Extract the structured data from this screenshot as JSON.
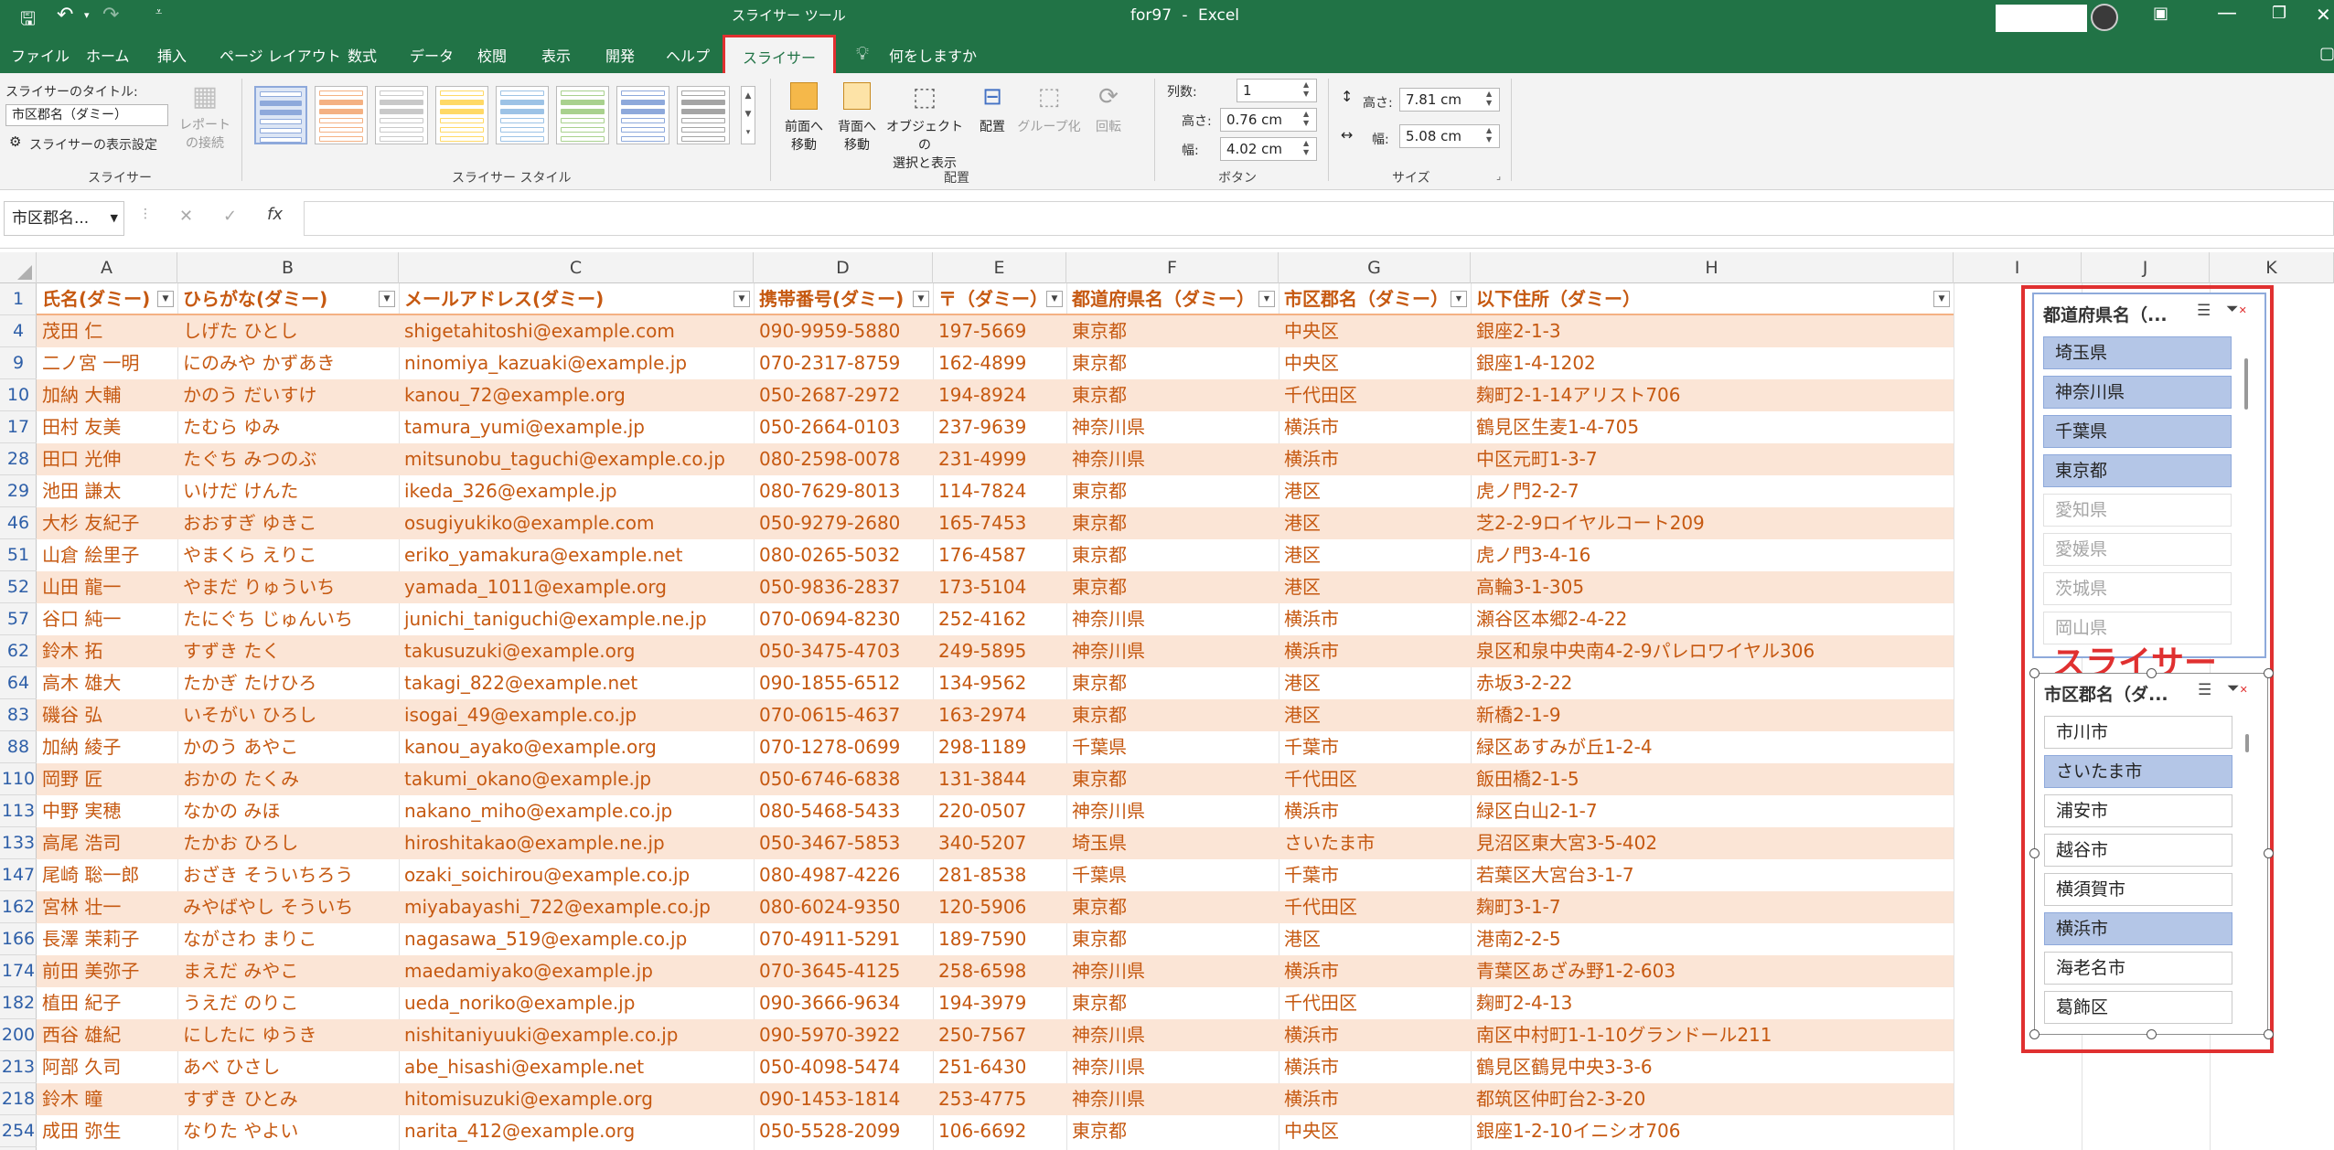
{
  "window": {
    "file_name": "for97",
    "separator": "-",
    "app_name": "Excel",
    "context_tool": "スライサー ツール"
  },
  "tabs": [
    "ファイル",
    "ホーム",
    "挿入",
    "ページ レイアウト",
    "数式",
    "データ",
    "校閲",
    "表示",
    "開発",
    "ヘルプ",
    "スライサー"
  ],
  "active_tab": "スライサー",
  "tell_me": "何をしますか",
  "ribbon": {
    "slicer_caption_label": "スライサーのタイトル:",
    "slicer_caption_value": "市区郡名（ダミー）",
    "slicer_settings": "スライサーの表示設定",
    "report_connections": [
      "レポート",
      "の接続"
    ],
    "group_slicer": "スライサー",
    "group_styles": "スライサー スタイル",
    "bring_forward": [
      "前面へ",
      "移動"
    ],
    "send_backward": [
      "背面へ",
      "移動"
    ],
    "selection_pane": [
      "オブジェクトの",
      "選択と表示"
    ],
    "align": "配置",
    "group": "グループ化",
    "rotate": "回転",
    "group_arrange": "配置",
    "columns_label": "列数:",
    "columns_value": "1",
    "btn_height_label": "高さ:",
    "btn_height_value": "0.76 cm",
    "btn_width_label": "幅:",
    "btn_width_value": "4.02 cm",
    "group_buttons": "ボタン",
    "size_height_label": "高さ:",
    "size_height_value": "7.81 cm",
    "size_width_label": "幅:",
    "size_width_value": "5.08 cm",
    "group_size": "サイズ"
  },
  "style_colors": [
    "#8ea9db",
    "#f4b183",
    "#c9c9c9",
    "#ffd966",
    "#9dc3e6",
    "#a9d18e",
    "#8ea9db",
    "#a5a5a5",
    "#9dc3e6"
  ],
  "formula_bar": {
    "name_box": "市区郡名...",
    "cancel": "✕",
    "enter": "✓",
    "fx": "fx",
    "formula": ""
  },
  "columns": [
    "A",
    "B",
    "C",
    "D",
    "E",
    "F",
    "G",
    "H",
    "I",
    "J",
    "K"
  ],
  "table_headers": [
    "氏名(ダミー)",
    "ひらがな(ダミー)",
    "メールアドレス(ダミー)",
    "携帯番号(ダミー)",
    "〒（ダミー）",
    "都道府県名（ダミー）",
    "市区郡名（ダミー）",
    "以下住所（ダミー）"
  ],
  "header_row_number": "1",
  "rows": [
    {
      "n": "4",
      "c": [
        "茂田 仁",
        "しげた ひとし",
        "shigetahitoshi@example.com",
        "090-9959-5880",
        "197-5669",
        "東京都",
        "中央区",
        "銀座2-1-3"
      ]
    },
    {
      "n": "9",
      "c": [
        "二ノ宮 一明",
        "にのみや かずあき",
        "ninomiya_kazuaki@example.jp",
        "070-2317-8759",
        "162-4899",
        "東京都",
        "中央区",
        "銀座1-4-1202"
      ]
    },
    {
      "n": "10",
      "c": [
        "加納 大輔",
        "かのう だいすけ",
        "kanou_72@example.org",
        "050-2687-2972",
        "194-8924",
        "東京都",
        "千代田区",
        "麹町2-1-14アリスト706"
      ]
    },
    {
      "n": "17",
      "c": [
        "田村 友美",
        "たむら ゆみ",
        "tamura_yumi@example.jp",
        "050-2664-0103",
        "237-9639",
        "神奈川県",
        "横浜市",
        "鶴見区生麦1-4-705"
      ]
    },
    {
      "n": "28",
      "c": [
        "田口 光伸",
        "たぐち みつのぶ",
        "mitsunobu_taguchi@example.co.jp",
        "080-2598-0078",
        "231-4999",
        "神奈川県",
        "横浜市",
        "中区元町1-3-7"
      ]
    },
    {
      "n": "29",
      "c": [
        "池田 謙太",
        "いけだ けんた",
        "ikeda_326@example.jp",
        "080-7629-8013",
        "114-7824",
        "東京都",
        "港区",
        "虎ノ門2-2-7"
      ]
    },
    {
      "n": "46",
      "c": [
        "大杉 友紀子",
        "おおすぎ ゆきこ",
        "osugiyukiko@example.com",
        "050-9279-2680",
        "165-7453",
        "東京都",
        "港区",
        "芝2-2-9ロイヤルコート209"
      ]
    },
    {
      "n": "51",
      "c": [
        "山倉 絵里子",
        "やまくら えりこ",
        "eriko_yamakura@example.net",
        "080-0265-5032",
        "176-4587",
        "東京都",
        "港区",
        "虎ノ門3-4-16"
      ]
    },
    {
      "n": "52",
      "c": [
        "山田 龍一",
        "やまだ りゅういち",
        "yamada_1011@example.org",
        "050-9836-2837",
        "173-5104",
        "東京都",
        "港区",
        "高輪3-1-305"
      ]
    },
    {
      "n": "57",
      "c": [
        "谷口 純一",
        "たにぐち じゅんいち",
        "junichi_taniguchi@example.ne.jp",
        "070-0694-8230",
        "252-4162",
        "神奈川県",
        "横浜市",
        "瀬谷区本郷2-4-22"
      ]
    },
    {
      "n": "62",
      "c": [
        "鈴木 拓",
        "すずき たく",
        "takusuzuki@example.org",
        "050-3475-4703",
        "249-5895",
        "神奈川県",
        "横浜市",
        "泉区和泉中央南4-2-9パレロワイヤル306"
      ]
    },
    {
      "n": "64",
      "c": [
        "高木 雄大",
        "たかぎ たけひろ",
        "takagi_822@example.net",
        "090-1855-6512",
        "134-9562",
        "東京都",
        "港区",
        "赤坂3-2-22"
      ]
    },
    {
      "n": "83",
      "c": [
        "磯谷 弘",
        "いそがい ひろし",
        "isogai_49@example.co.jp",
        "070-0615-4637",
        "163-2974",
        "東京都",
        "港区",
        "新橋2-1-9"
      ]
    },
    {
      "n": "88",
      "c": [
        "加納 綾子",
        "かのう あやこ",
        "kanou_ayako@example.org",
        "070-1278-0699",
        "298-1189",
        "千葉県",
        "千葉市",
        "緑区あすみが丘1-2-4"
      ]
    },
    {
      "n": "110",
      "c": [
        "岡野 匠",
        "おかの たくみ",
        "takumi_okano@example.jp",
        "050-6746-6838",
        "131-3844",
        "東京都",
        "千代田区",
        "飯田橋2-1-5"
      ]
    },
    {
      "n": "113",
      "c": [
        "中野 実穂",
        "なかの みほ",
        "nakano_miho@example.co.jp",
        "080-5468-5433",
        "220-0507",
        "神奈川県",
        "横浜市",
        "緑区白山2-1-7"
      ]
    },
    {
      "n": "133",
      "c": [
        "高尾 浩司",
        "たかお ひろし",
        "hiroshitakao@example.ne.jp",
        "050-3467-5853",
        "340-5207",
        "埼玉県",
        "さいたま市",
        "見沼区東大宮3-5-402"
      ]
    },
    {
      "n": "147",
      "c": [
        "尾崎 聡一郎",
        "おざき そういちろう",
        "ozaki_soichirou@example.co.jp",
        "080-4987-4226",
        "281-8538",
        "千葉県",
        "千葉市",
        "若葉区大宮台3-1-7"
      ]
    },
    {
      "n": "162",
      "c": [
        "宮林 壮一",
        "みやばやし そういち",
        "miyabayashi_722@example.co.jp",
        "080-6024-9350",
        "120-5906",
        "東京都",
        "千代田区",
        "麹町3-1-7"
      ]
    },
    {
      "n": "166",
      "c": [
        "長澤 茉莉子",
        "ながさわ まりこ",
        "nagasawa_519@example.co.jp",
        "070-4911-5291",
        "189-7590",
        "東京都",
        "港区",
        "港南2-2-5"
      ]
    },
    {
      "n": "174",
      "c": [
        "前田 美弥子",
        "まえだ みやこ",
        "maedamiyako@example.jp",
        "070-3645-4125",
        "258-6598",
        "神奈川県",
        "横浜市",
        "青葉区あざみ野1-2-603"
      ]
    },
    {
      "n": "182",
      "c": [
        "植田 紀子",
        "うえだ のりこ",
        "ueda_noriko@example.jp",
        "090-3666-9634",
        "194-3979",
        "東京都",
        "千代田区",
        "麹町2-4-13"
      ]
    },
    {
      "n": "200",
      "c": [
        "西谷 雄紀",
        "にしたに ゆうき",
        "nishitaniyuuki@example.co.jp",
        "090-5970-3922",
        "250-7567",
        "神奈川県",
        "横浜市",
        "南区中村町1-1-10グランドール211"
      ]
    },
    {
      "n": "213",
      "c": [
        "阿部 久司",
        "あべ ひさし",
        "abe_hisashi@example.net",
        "050-4098-5474",
        "251-6430",
        "神奈川県",
        "横浜市",
        "鶴見区鶴見中央3-3-6"
      ]
    },
    {
      "n": "218",
      "c": [
        "鈴木 瞳",
        "すずき ひとみ",
        "hitomisuzuki@example.org",
        "090-1453-1814",
        "253-4775",
        "神奈川県",
        "横浜市",
        "都筑区仲町台2-3-20"
      ]
    },
    {
      "n": "254",
      "c": [
        "成田 弥生",
        "なりた やよい",
        "narita_412@example.org",
        "050-5528-2099",
        "106-6692",
        "東京都",
        "中央区",
        "銀座1-2-10イニシオ706"
      ]
    }
  ],
  "slicer_prefecture": {
    "title": "都道府県名（...",
    "items": [
      {
        "label": "埼玉県",
        "state": "selected"
      },
      {
        "label": "神奈川県",
        "state": "selected"
      },
      {
        "label": "千葉県",
        "state": "selected"
      },
      {
        "label": "東京都",
        "state": "selected"
      },
      {
        "label": "愛知県",
        "state": "nodata"
      },
      {
        "label": "愛媛県",
        "state": "nodata"
      },
      {
        "label": "茨城県",
        "state": "nodata"
      },
      {
        "label": "岡山県",
        "state": "nodata"
      }
    ]
  },
  "slicer_city": {
    "title": "市区郡名（ダ...",
    "items": [
      {
        "label": "市川市",
        "state": "unselected"
      },
      {
        "label": "さいたま市",
        "state": "selected"
      },
      {
        "label": "浦安市",
        "state": "unselected"
      },
      {
        "label": "越谷市",
        "state": "unselected"
      },
      {
        "label": "横須賀市",
        "state": "unselected"
      },
      {
        "label": "横浜市",
        "state": "selected"
      },
      {
        "label": "海老名市",
        "state": "unselected"
      },
      {
        "label": "葛飾区",
        "state": "unselected"
      }
    ]
  },
  "annotation": "スライサー",
  "colors": {
    "excel_green": "#217346",
    "accent_red": "#e03030",
    "table_orange": "#c65911",
    "band": "#fbe5d6"
  }
}
